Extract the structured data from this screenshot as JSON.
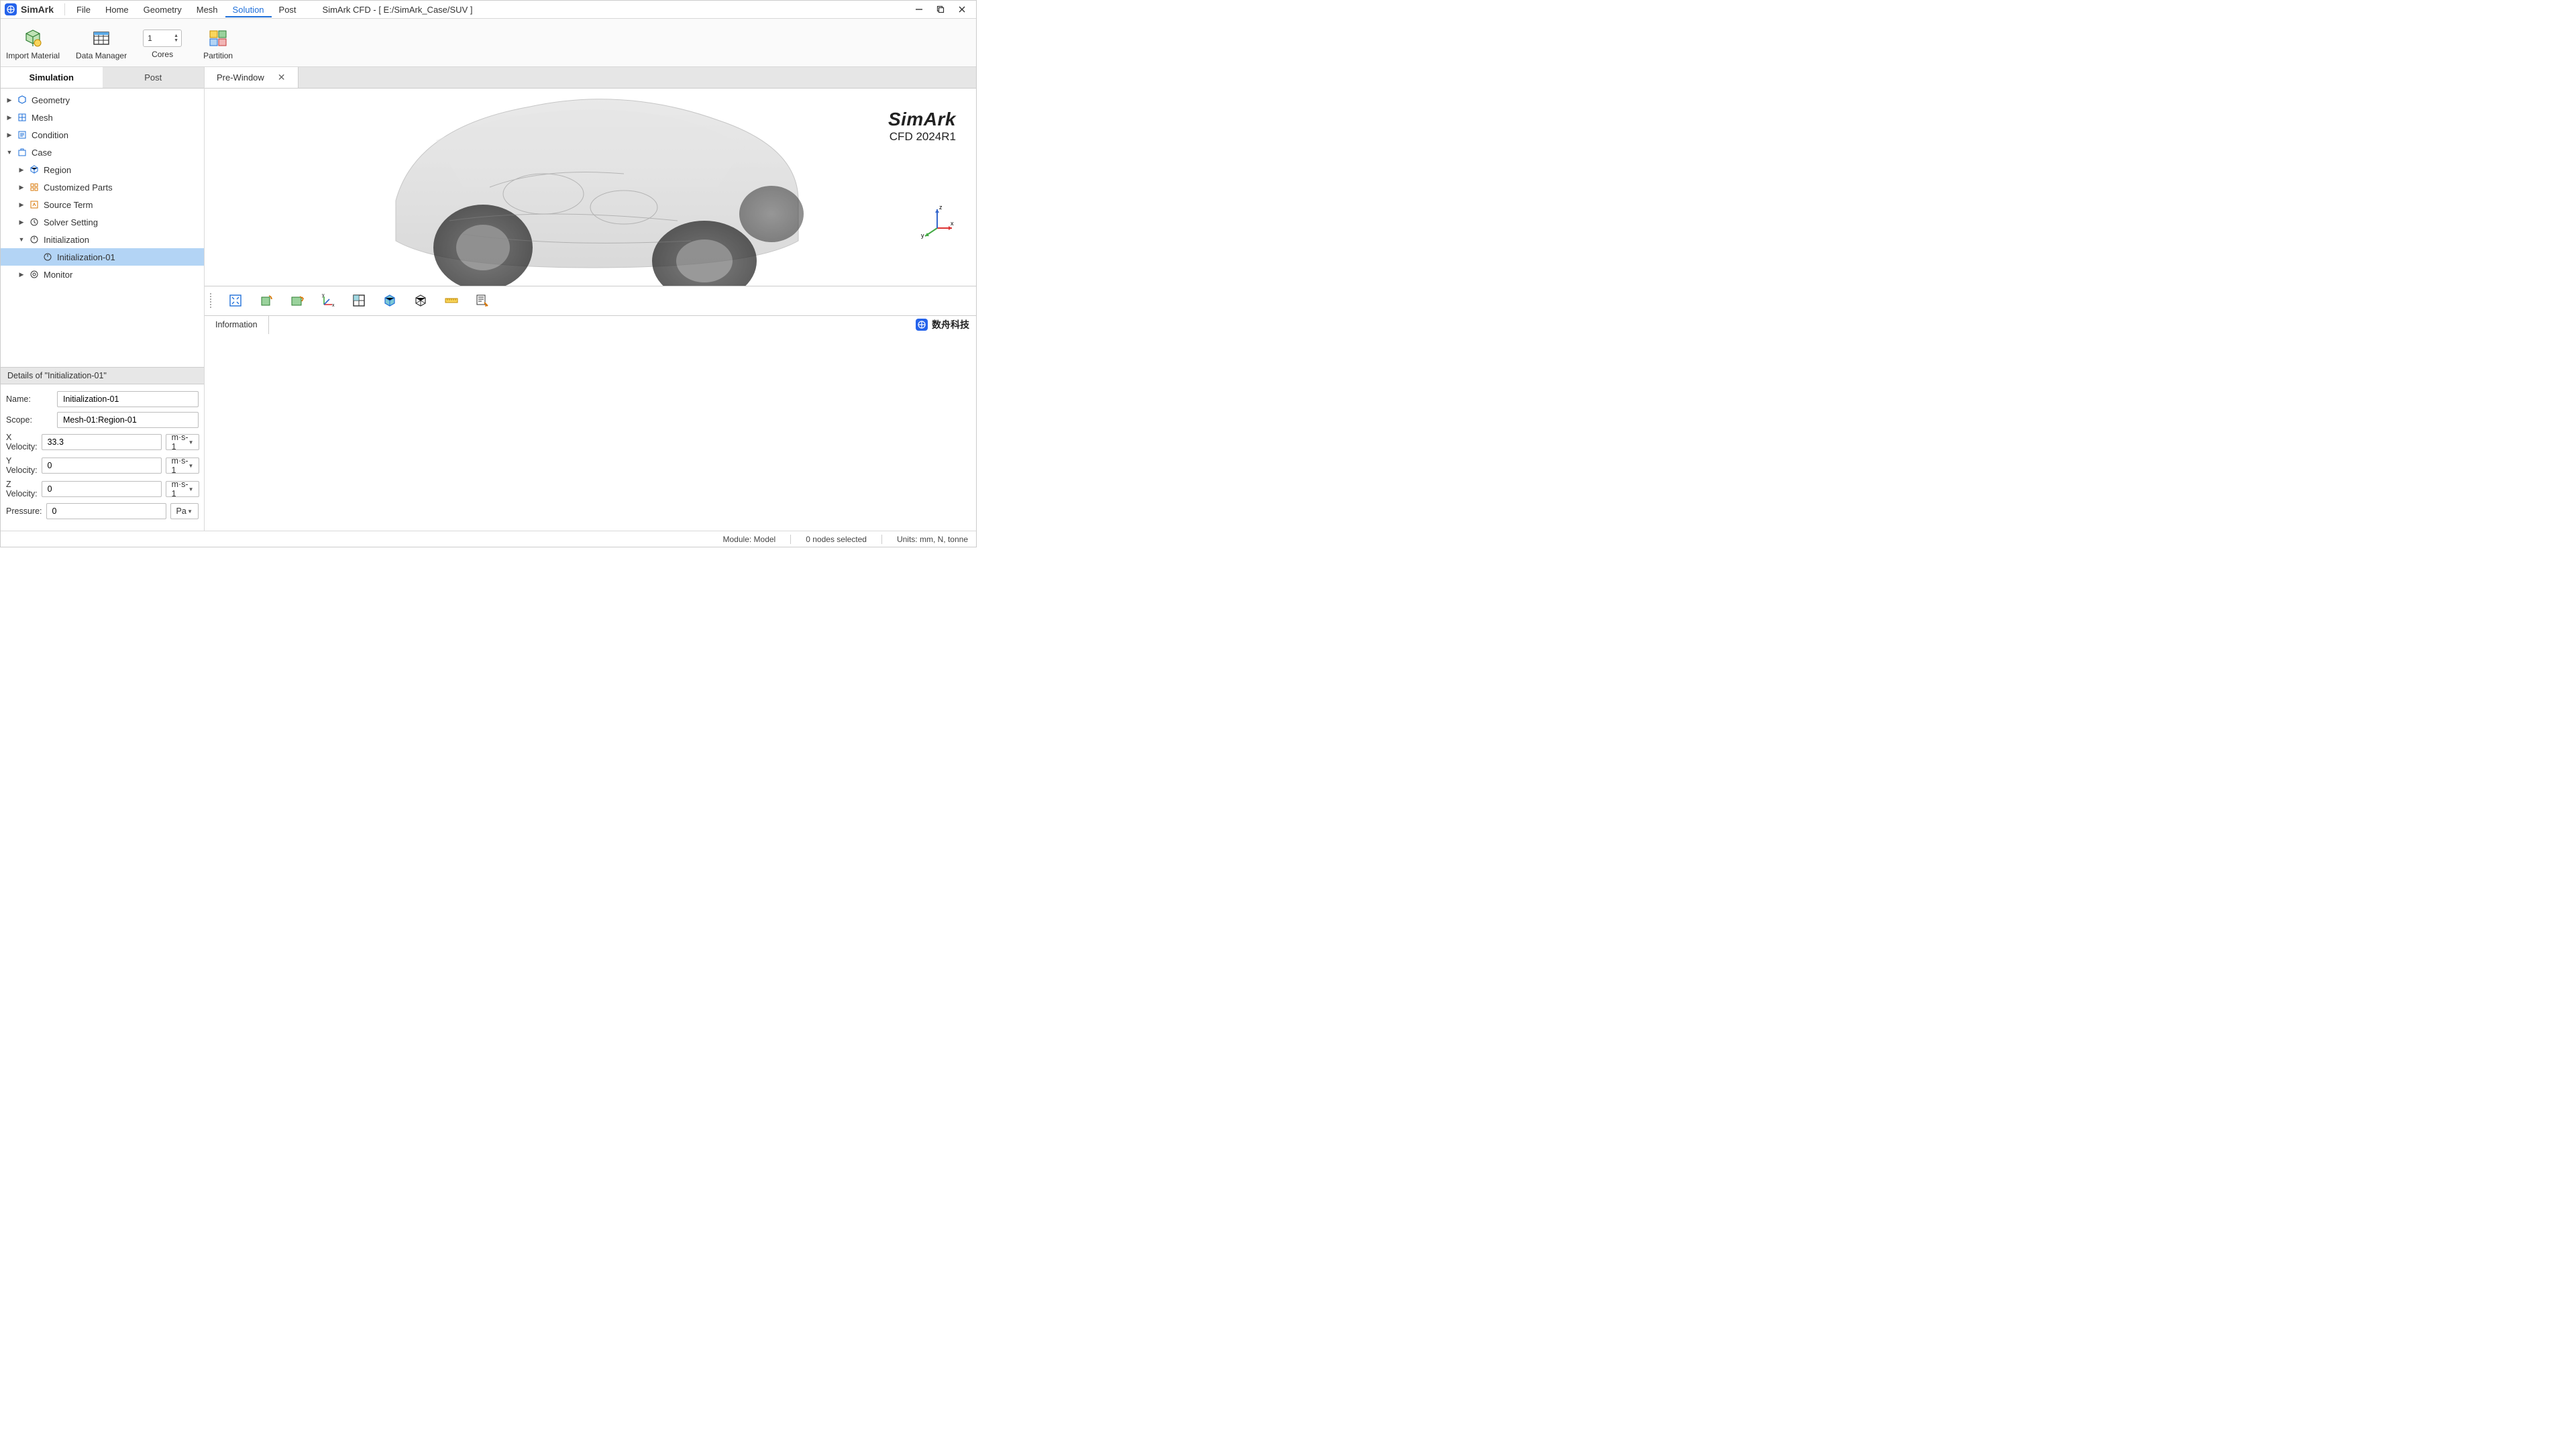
{
  "app": {
    "name": "SimArk",
    "logo_glyph": "⊕"
  },
  "menu": {
    "items": [
      "File",
      "Home",
      "Geometry",
      "Mesh",
      "Solution",
      "Post"
    ],
    "active_index": 4
  },
  "project_title": "SimArk CFD - [ E:/SimArk_Case/SUV ]",
  "ribbon": {
    "import_material": "Import Material",
    "data_manager": "Data Manager",
    "cores_label": "Cores",
    "cores_value": "1",
    "partition": "Partition"
  },
  "side_tabs": {
    "simulation": "Simulation",
    "post": "Post",
    "active": 0
  },
  "tree": {
    "geometry": "Geometry",
    "mesh": "Mesh",
    "condition": "Condition",
    "case": "Case",
    "region": "Region",
    "custom_parts": "Customized Parts",
    "source_term": "Source Term",
    "solver_setting": "Solver Setting",
    "initialization": "Initialization",
    "initialization_01": "Initialization-01",
    "monitor": "Monitor"
  },
  "details": {
    "header": "Details of \"Initialization-01\"",
    "rows": {
      "name_label": "Name:",
      "name_value": "Initialization-01",
      "scope_label": "Scope:",
      "scope_value": "Mesh-01:Region-01",
      "xvel_label": "X Velocity:",
      "xvel_value": "33.3",
      "xvel_unit": "m·s-1",
      "yvel_label": "Y Velocity:",
      "yvel_value": "0",
      "yvel_unit": "m·s-1",
      "zvel_label": "Z Velocity:",
      "zvel_value": "0",
      "zvel_unit": "m·s-1",
      "press_label": "Pressure:",
      "press_value": "0",
      "press_unit": "Pa"
    }
  },
  "doc_tab": {
    "label": "Pre-Window"
  },
  "watermark": {
    "line1": "SimArk",
    "line2": "CFD 2024R1"
  },
  "triad": {
    "x": "x",
    "y": "y",
    "z": "z"
  },
  "info_tab": "Information",
  "brand2": {
    "glyph": "⊕",
    "text": "数舟科技"
  },
  "status": {
    "module": "Module: Model",
    "nodes": "0 nodes selected",
    "units": "Units: mm, N, tonne"
  }
}
